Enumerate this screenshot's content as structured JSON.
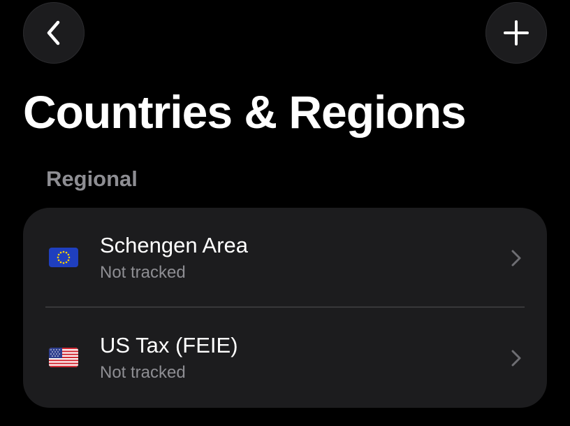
{
  "header": {
    "back_icon": "chevron-left-icon",
    "add_icon": "plus-icon",
    "title": "Countries & Regions"
  },
  "section": {
    "label": "Regional"
  },
  "items": [
    {
      "flag_icon": "eu-flag-icon",
      "title": "Schengen Area",
      "status": "Not tracked",
      "chevron_icon": "chevron-right-icon"
    },
    {
      "flag_icon": "us-flag-icon",
      "title": "US Tax (FEIE)",
      "status": "Not tracked",
      "chevron_icon": "chevron-right-icon"
    }
  ],
  "colors": {
    "background": "#000000",
    "card": "#1c1c1e",
    "primary_text": "#ffffff",
    "secondary_text": "#8e8e93",
    "separator": "#38383a"
  }
}
